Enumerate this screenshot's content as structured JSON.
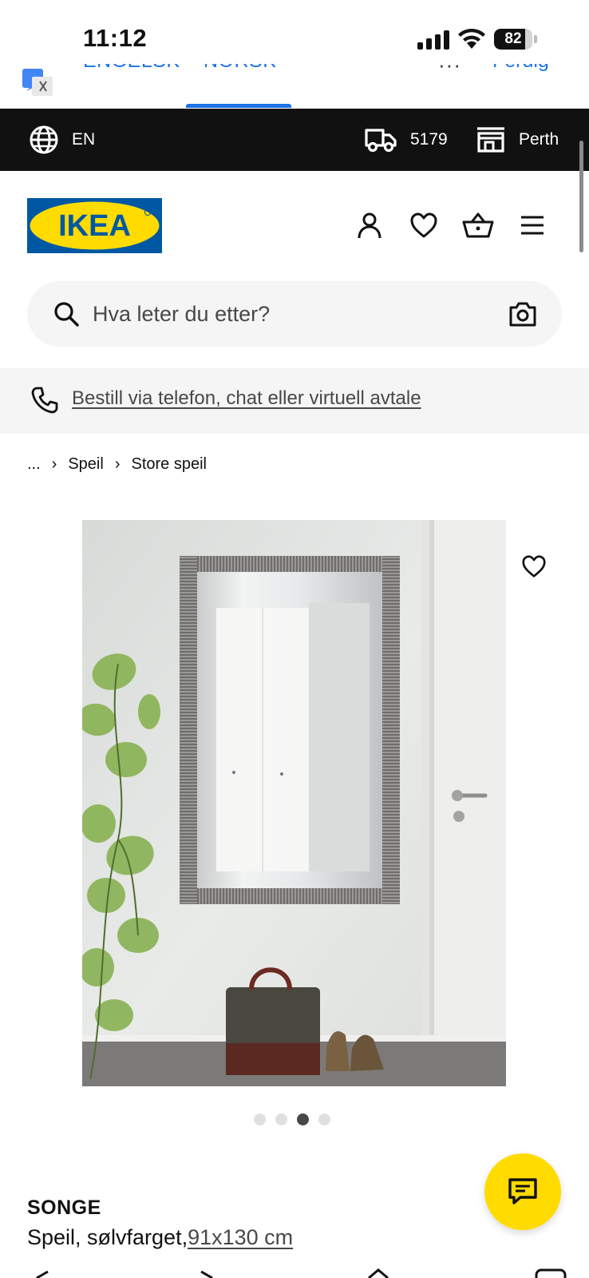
{
  "status_bar": {
    "time": "11:12",
    "battery": "82",
    "battery_level": 0.82
  },
  "translate_bar": {
    "lang_source": "ENGELSK",
    "lang_target": "NORSK",
    "more": "···",
    "done": "Ferdig"
  },
  "top_bar": {
    "language": "EN",
    "postcode": "5179",
    "store": "Perth"
  },
  "header": {
    "logo_text": "IKEA",
    "icons": [
      "profile-icon",
      "heart-icon",
      "basket-icon",
      "menu-icon"
    ]
  },
  "search": {
    "placeholder": "Hva leter du etter?"
  },
  "order_strip": {
    "link": "Bestill via telefon, chat eller virtuell avtale"
  },
  "breadcrumb": {
    "items": [
      "...",
      "Speil",
      "Store speil"
    ]
  },
  "carousel": {
    "count": 4,
    "active_index": 2
  },
  "product": {
    "name": "SONGE",
    "description": "Speil, sølvfarget,",
    "size": "91x130 cm"
  },
  "colors": {
    "ikea_blue": "#0058a3",
    "ikea_yellow": "#ffdb00",
    "link_blue": "#1a73e8",
    "top_bar_bg": "#111111"
  }
}
